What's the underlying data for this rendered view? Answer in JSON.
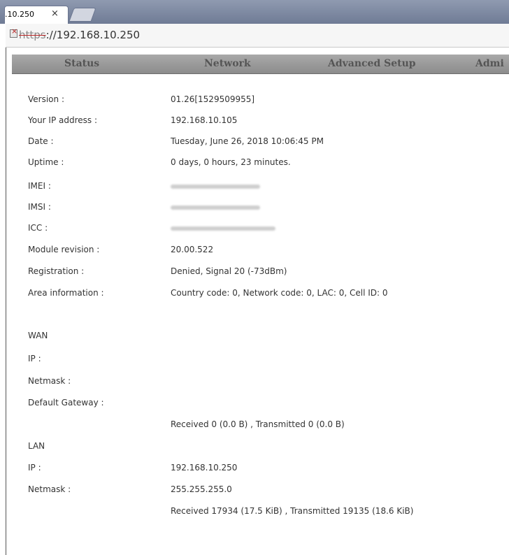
{
  "browser": {
    "tab_title": ".10.250",
    "tab_close": "×",
    "url_scheme": "https",
    "url_rest": "://192.168.10.250"
  },
  "nav": {
    "items": [
      "Status",
      "Network",
      "Advanced Setup",
      "Admi"
    ]
  },
  "status": {
    "rows": [
      {
        "label": "Version :",
        "value": "01.26[1529509955]"
      },
      {
        "label": "Your IP address :",
        "value": "192.168.10.105"
      },
      {
        "label": "Date :",
        "value": "Tuesday, June 26, 2018 10:06:45 PM"
      },
      {
        "label": "Uptime :",
        "value": "0 days, 0 hours, 23 minutes."
      },
      {
        "label": "IMEI :",
        "value": ""
      },
      {
        "label": "IMSI :",
        "value": ""
      },
      {
        "label": "ICC :",
        "value": ""
      },
      {
        "label": "Module revision :",
        "value": "20.00.522"
      },
      {
        "label": "Registration :",
        "value": "Denied, Signal 20 (-73dBm)"
      },
      {
        "label": "Area information :",
        "value": "Country code: 0, Network code: 0, LAC: 0, Cell ID: 0"
      }
    ]
  },
  "wan": {
    "heading": "WAN",
    "ip_label": "IP :",
    "netmask_label": "Netmask :",
    "gateway_label": "Default Gateway :",
    "traffic": "Received 0 (0.0 B) , Transmitted 0 (0.0 B)"
  },
  "lan": {
    "heading": "LAN",
    "ip_label": "IP :",
    "ip_value": "192.168.10.250",
    "netmask_label": "Netmask :",
    "netmask_value": "255.255.255.0",
    "traffic": "Received 17934 (17.5 KiB) , Transmitted 19135 (18.6 KiB)"
  }
}
